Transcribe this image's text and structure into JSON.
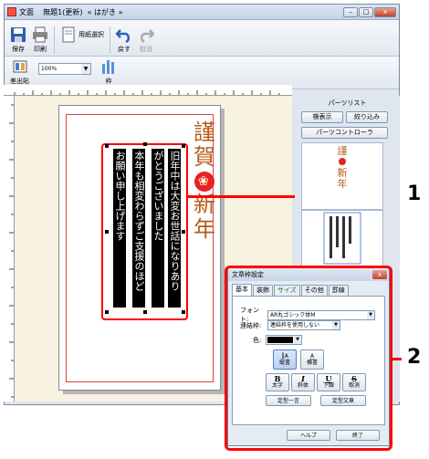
{
  "window": {
    "title": "文面    無題1(更新)  « はがき »",
    "buttons": {
      "minimize": "–",
      "maximize": "□",
      "close": "x"
    }
  },
  "toolbar": {
    "save": "保存",
    "print": "印刷",
    "paper_select": "用紙選択",
    "undo": "戻す",
    "redo": "取消",
    "sashidashi": "差出貼",
    "zoom": "100%",
    "frame": "枠"
  },
  "canvas": {
    "greeting_chars": [
      "謹",
      "賀",
      "新",
      "年"
    ],
    "columns": [
      "旧年中は大変お世話になりあり",
      "がとうございました",
      "本年も相変わらずご支援のほど",
      "お願い申し上げます"
    ]
  },
  "callouts": [
    "1",
    "2"
  ],
  "parts_panel": {
    "title": "パーツリスト",
    "btn_search": "検表示",
    "btn_filter": "絞り込み",
    "btn_controller": "パーツコントローラ",
    "thumb_chars": [
      "謹",
      "賀",
      "新",
      "年"
    ]
  },
  "dialog": {
    "title": "文章枠設定",
    "close": "x",
    "tabs": [
      "基本",
      "装飾",
      "サイズ",
      "その他",
      "罫線"
    ],
    "font_label": "フォント:",
    "font_value": "AR丸ゴシック体M",
    "linked_label": "連結枠:",
    "linked_value": "連結枠を使用しない",
    "color_label": "色:",
    "btn_vertical": "縦書",
    "btn_horizontal": "横書",
    "btn_bold_glyph": "B",
    "btn_bold": "太字",
    "btn_italic_glyph": "I",
    "btn_italic": "斜体",
    "btn_underline_glyph": "U",
    "btn_underline": "下線",
    "btn_strike_glyph": "S",
    "btn_strike": "取消",
    "btn_teikei_ichigen": "定型一言",
    "btn_teikei_bunsho": "定型文章",
    "btn_help": "ヘルプ",
    "btn_close": "終了"
  }
}
